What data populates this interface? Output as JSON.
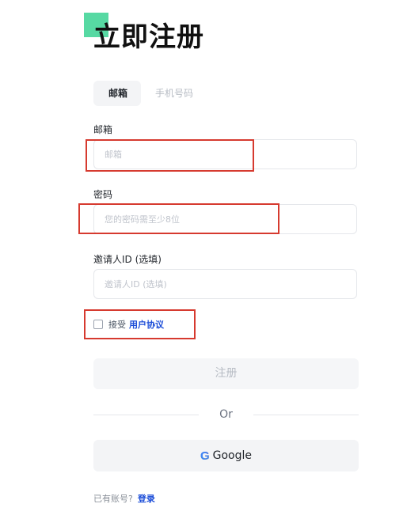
{
  "page": {
    "title": "立即注册"
  },
  "tabs": [
    {
      "label": "邮箱",
      "active": true
    },
    {
      "label": "手机号码",
      "active": false
    }
  ],
  "fields": {
    "email": {
      "label": "邮箱",
      "placeholder": "邮箱",
      "value": ""
    },
    "password": {
      "label": "密码",
      "placeholder": "您的密码需至少8位",
      "value": ""
    },
    "referrer": {
      "label": "邀请人ID (选填)",
      "placeholder": "邀请人ID (选填)",
      "value": ""
    }
  },
  "agreement": {
    "checked": false,
    "prefix": "接受",
    "link_text": "用户协议"
  },
  "register_button": {
    "label": "注册"
  },
  "divider": {
    "text": "Or"
  },
  "google_button": {
    "icon": "google-icon",
    "label": "Google"
  },
  "footer": {
    "prompt": "已有账号?",
    "login_link": "登录"
  },
  "colors": {
    "accent": "#57d9a3",
    "link": "#1d4ed8",
    "highlight_box": "#d63a2f"
  }
}
